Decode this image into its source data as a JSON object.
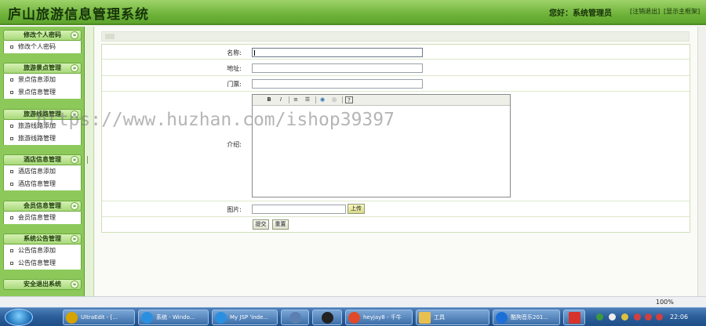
{
  "header": {
    "title": "庐山旅游信息管理系统",
    "greeting": "您好：系统管理员",
    "logout_link": "[注销退出]",
    "home_link": "[显示主框架]"
  },
  "sidebar": {
    "groups": [
      {
        "title": "修改个人密码",
        "items": [
          "修改个人密码"
        ]
      },
      {
        "title": "旅游景点管理",
        "items": [
          "景点信息添加",
          "景点信息管理"
        ]
      },
      {
        "title": "旅游线路管理",
        "items": [
          "旅游线路添加",
          "旅游线路管理"
        ]
      },
      {
        "title": "酒店信息管理",
        "items": [
          "酒店信息添加",
          "酒店信息管理"
        ]
      },
      {
        "title": "会员信息管理",
        "items": [
          "会员信息管理"
        ]
      },
      {
        "title": "系统公告管理",
        "items": [
          "公告信息添加",
          "公告信息管理"
        ]
      },
      {
        "title": "安全退出系统",
        "items": []
      }
    ],
    "toggle_symbol": "»"
  },
  "form": {
    "name_label": "名称:",
    "address_label": "地址:",
    "ticket_label": "门票:",
    "intro_label": "介绍:",
    "image_label": "图片:",
    "upload_button": "上传",
    "submit_button": "提交",
    "reset_button": "重置",
    "name_value": "",
    "address_value": "",
    "ticket_value": "",
    "image_value": "",
    "editor_tools": [
      "B",
      "I",
      "≡",
      "☰",
      "◉",
      "◎",
      "?"
    ]
  },
  "watermark": "https://www.huzhan.com/ishop39397",
  "statusbar": {
    "zoom": "100%"
  },
  "taskbar": {
    "items": [
      {
        "label": "UltraEdit - [...",
        "color": "#d6a400"
      },
      {
        "label": "系统 - Windo...",
        "color": "#2a8fe0"
      },
      {
        "label": "My JSP 'inde...",
        "color": "#2a8fe0"
      },
      {
        "label": "",
        "color": "#5b7fb0"
      },
      {
        "label": "",
        "color": "#222222"
      },
      {
        "label": "heyjay8 - 千牛",
        "color": "#e04a2a"
      },
      {
        "label": "工具",
        "color": "#e8c050"
      },
      {
        "label": "酷狗音乐201...",
        "color": "#1d6fd8"
      },
      {
        "label": "",
        "color": "#d8332a"
      }
    ],
    "clock": "22:06"
  }
}
